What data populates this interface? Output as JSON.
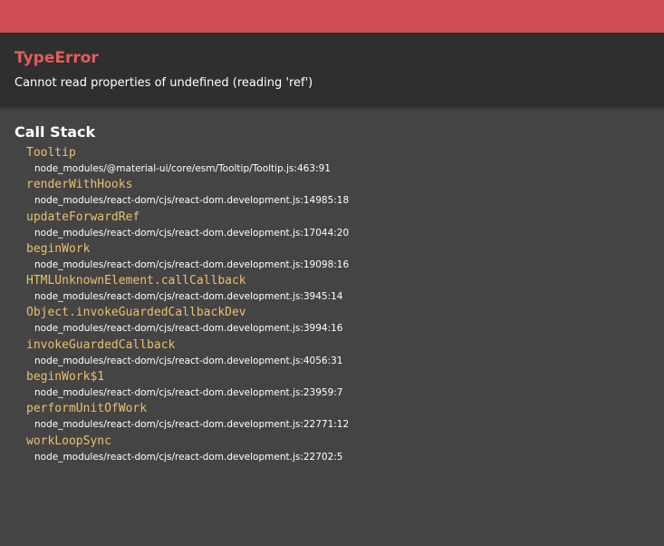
{
  "error": {
    "type": "TypeError",
    "message": "Cannot read properties of undefined (reading 'ref')"
  },
  "call_stack": {
    "title": "Call Stack",
    "frames": [
      {
        "fn": "Tooltip",
        "location": "node_modules/@material-ui/core/esm/Tooltip/Tooltip.js:463:91"
      },
      {
        "fn": "renderWithHooks",
        "location": "node_modules/react-dom/cjs/react-dom.development.js:14985:18"
      },
      {
        "fn": "updateForwardRef",
        "location": "node_modules/react-dom/cjs/react-dom.development.js:17044:20"
      },
      {
        "fn": "beginWork",
        "location": "node_modules/react-dom/cjs/react-dom.development.js:19098:16"
      },
      {
        "fn": "HTMLUnknownElement.callCallback",
        "location": "node_modules/react-dom/cjs/react-dom.development.js:3945:14"
      },
      {
        "fn": "Object.invokeGuardedCallbackDev",
        "location": "node_modules/react-dom/cjs/react-dom.development.js:3994:16"
      },
      {
        "fn": "invokeGuardedCallback",
        "location": "node_modules/react-dom/cjs/react-dom.development.js:4056:31"
      },
      {
        "fn": "beginWork$1",
        "location": "node_modules/react-dom/cjs/react-dom.development.js:23959:7"
      },
      {
        "fn": "performUnitOfWork",
        "location": "node_modules/react-dom/cjs/react-dom.development.js:22771:12"
      },
      {
        "fn": "workLoopSync",
        "location": "node_modules/react-dom/cjs/react-dom.development.js:22702:5"
      }
    ]
  },
  "colors": {
    "top_bar": "#d04d57",
    "error_title": "#e25c5c",
    "function_name": "#e8c06b",
    "header_bg": "#2f2f2f",
    "body_bg": "#444444"
  }
}
